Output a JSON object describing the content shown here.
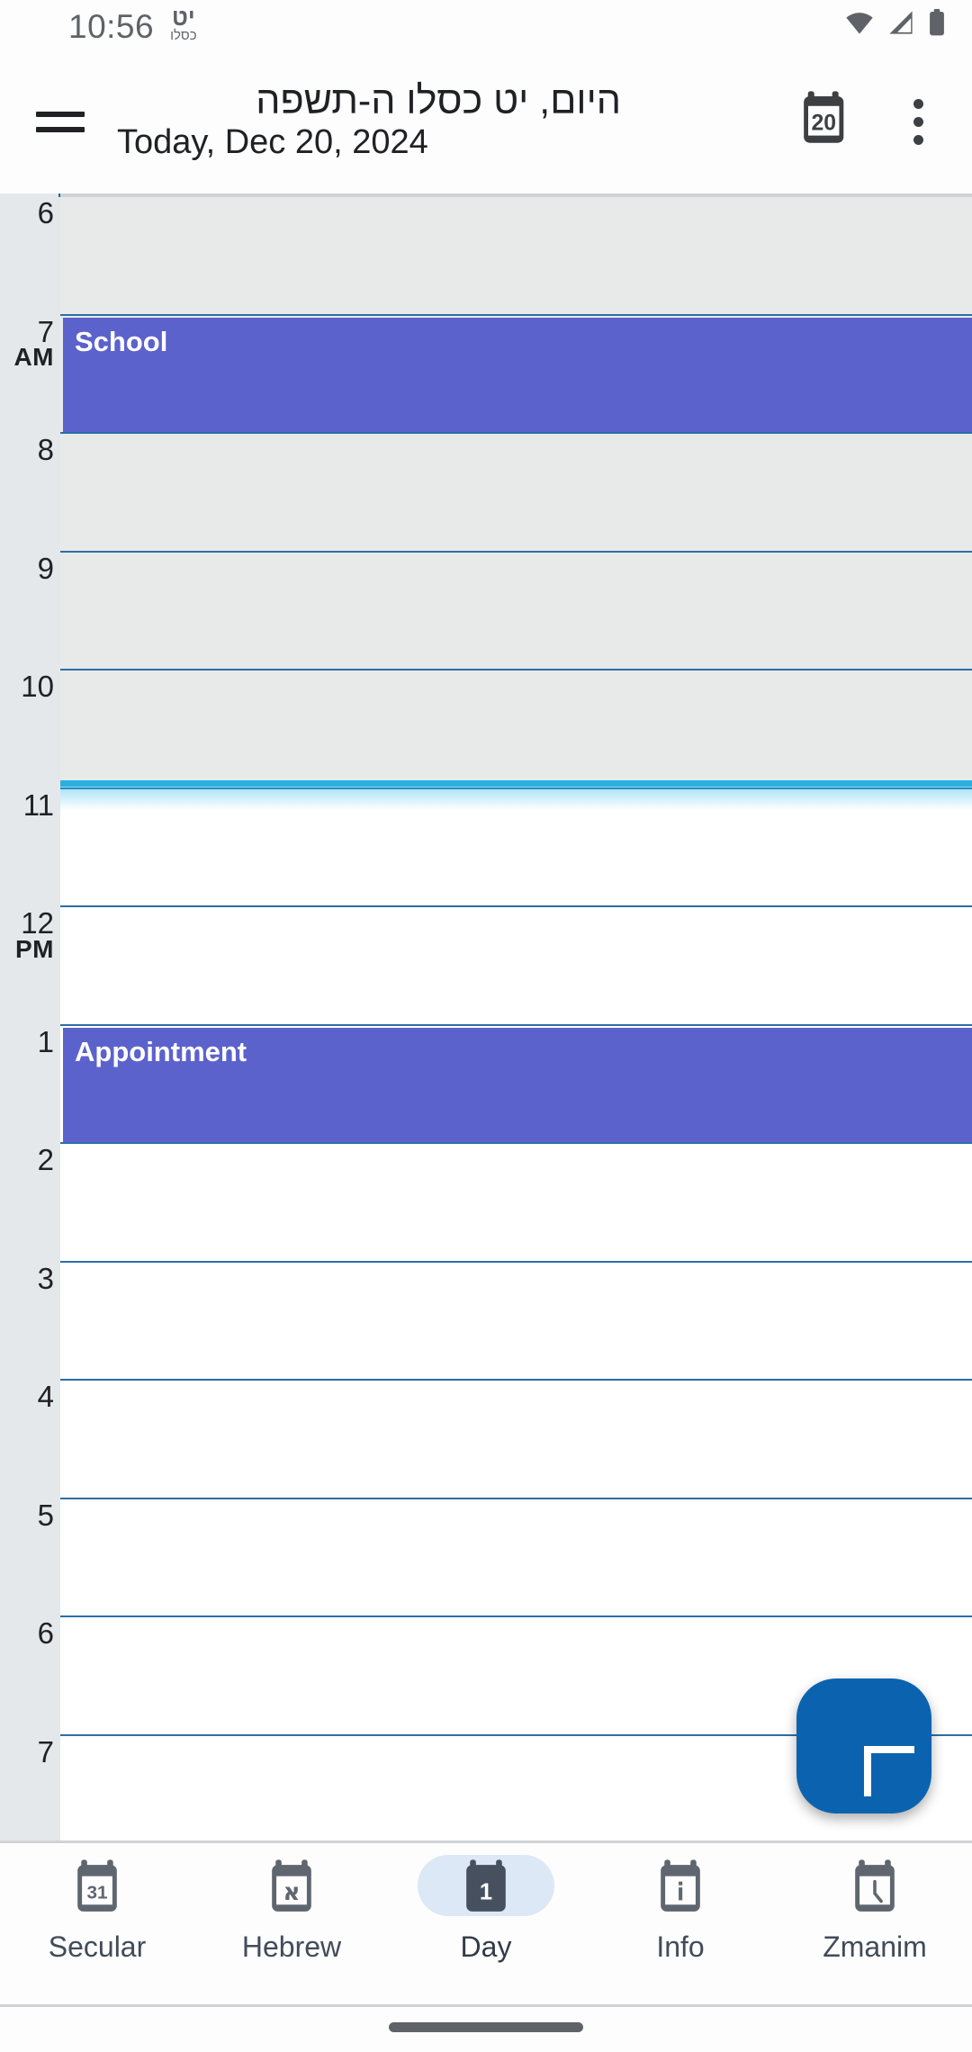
{
  "statusbar": {
    "time": "10:56",
    "hebrew_day": "יט",
    "hebrew_month": "כסלו",
    "icons": [
      "wifi-icon",
      "cellular-signal-icon",
      "battery-icon"
    ]
  },
  "appbar": {
    "menu_icon": "hamburger-menu-icon",
    "title_hebrew": "היום, יט כסלו ה-תשפה",
    "title_english": "Today, Dec 20, 2024",
    "calendar_icon_label": "20",
    "overflow_icon": "more-vertical-icon"
  },
  "grid": {
    "hours": [
      {
        "label": "6",
        "ampm": "",
        "past": true
      },
      {
        "label": "7",
        "ampm": "AM",
        "past": true
      },
      {
        "label": "8",
        "ampm": "",
        "past": true
      },
      {
        "label": "9",
        "ampm": "",
        "past": true
      },
      {
        "label": "10",
        "ampm": "",
        "past": true
      },
      {
        "label": "11",
        "ampm": "",
        "past": false
      },
      {
        "label": "12",
        "ampm": "PM",
        "past": false
      },
      {
        "label": "1",
        "ampm": "",
        "past": false
      },
      {
        "label": "2",
        "ampm": "",
        "past": false
      },
      {
        "label": "3",
        "ampm": "",
        "past": false
      },
      {
        "label": "4",
        "ampm": "",
        "past": false
      },
      {
        "label": "5",
        "ampm": "",
        "past": false
      },
      {
        "label": "6",
        "ampm": "",
        "past": false
      },
      {
        "label": "7",
        "ampm": "",
        "past": false
      }
    ],
    "events": [
      {
        "title": "School",
        "start_hour_index": 1,
        "duration_hours": 1,
        "color": "#5c62cc"
      },
      {
        "title": "Appointment",
        "start_hour_index": 7,
        "duration_hours": 1,
        "color": "#5c62cc"
      }
    ],
    "now_indicator": {
      "color": "#29b0e0",
      "at_hour_index": 4,
      "fraction": 0.93
    }
  },
  "fab": {
    "icon": "plus-icon",
    "color": "#0b63b0"
  },
  "bottomnav": {
    "items": [
      {
        "label": "Secular",
        "icon": "calendar-31-icon",
        "selected": false
      },
      {
        "label": "Hebrew",
        "icon": "calendar-aleph-icon",
        "selected": false
      },
      {
        "label": "Day",
        "icon": "calendar-1-icon",
        "selected": true
      },
      {
        "label": "Info",
        "icon": "calendar-info-icon",
        "selected": false
      },
      {
        "label": "Zmanim",
        "icon": "calendar-clock-icon",
        "selected": false
      }
    ],
    "selected_pill_color": "#dce8f5"
  }
}
